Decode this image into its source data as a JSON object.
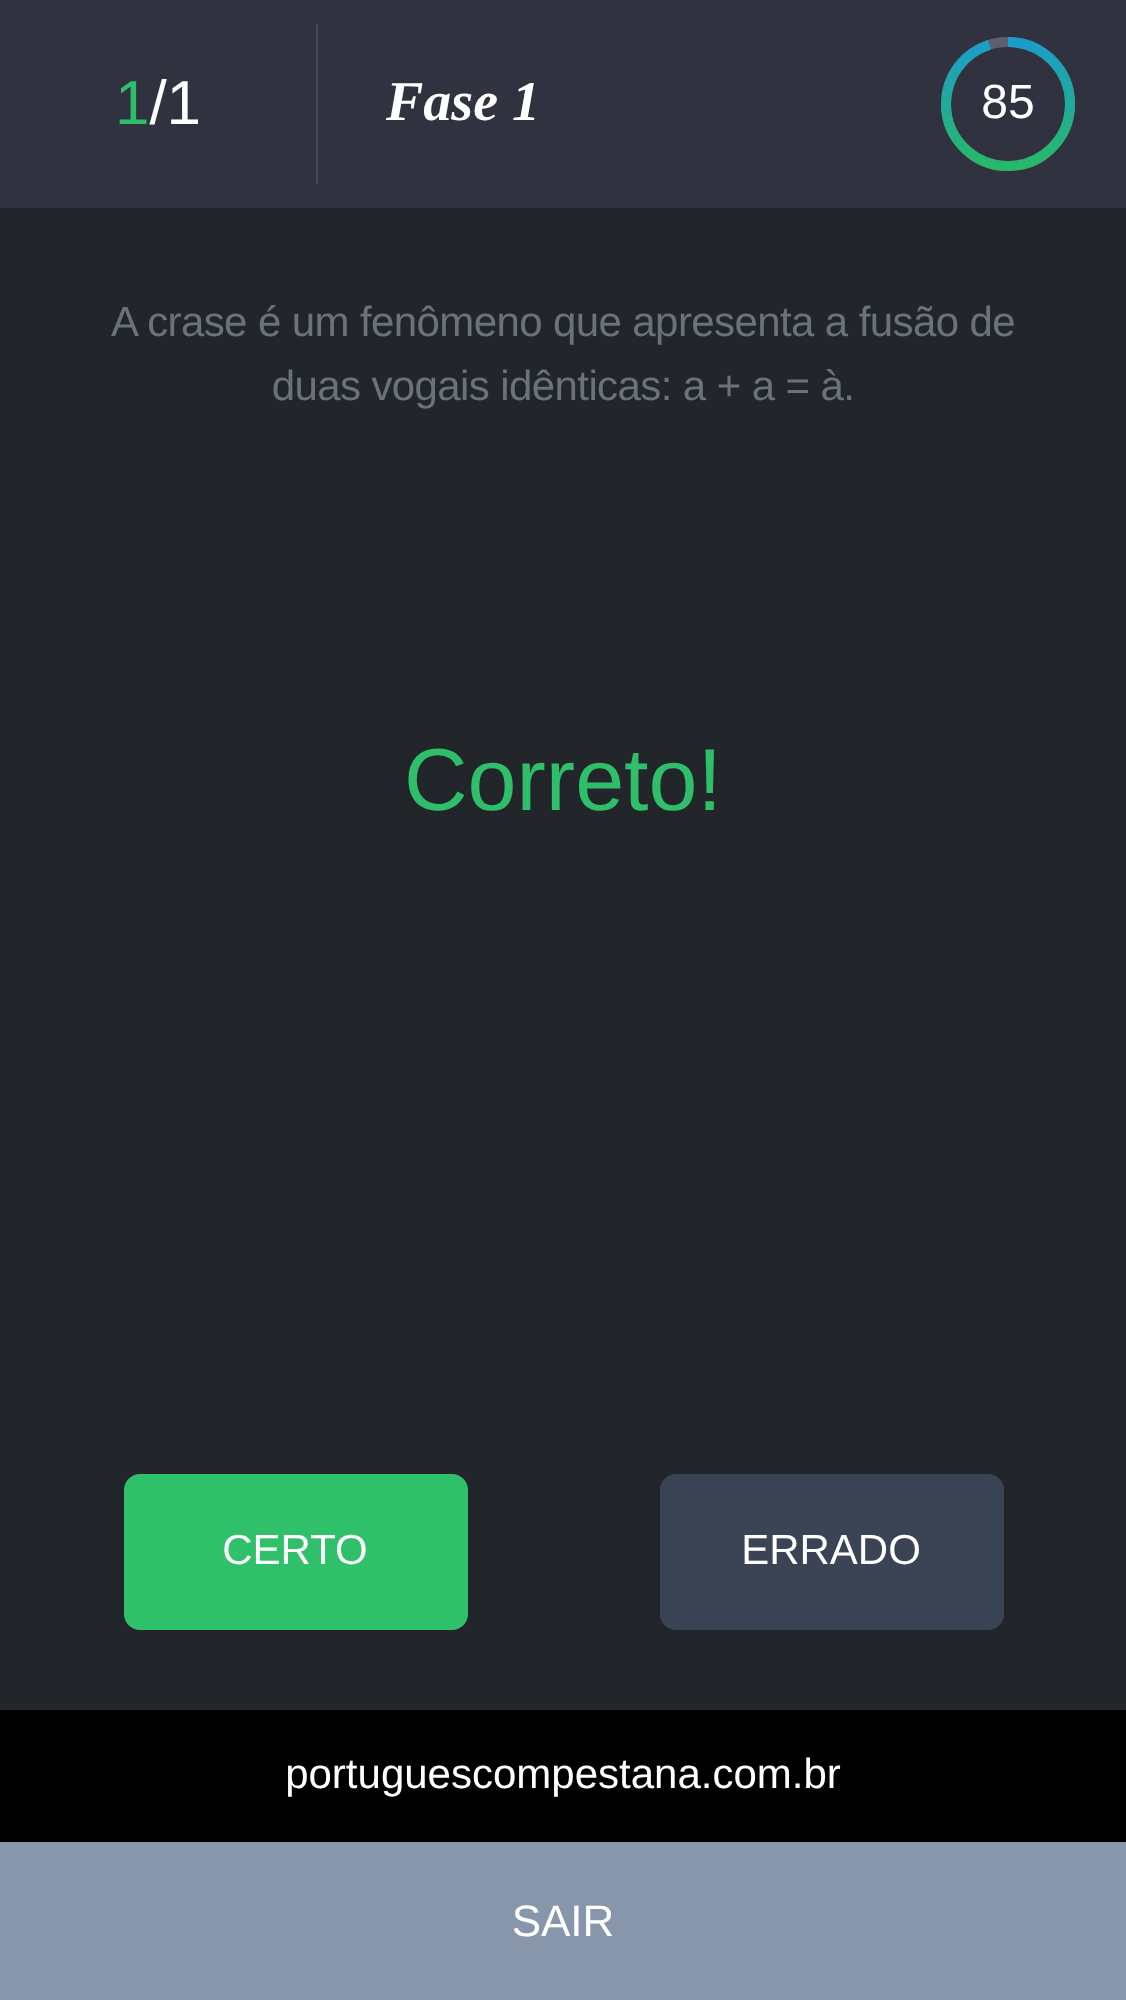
{
  "header": {
    "counter": {
      "current": "1",
      "total": "/1"
    },
    "title": "Fase 1",
    "timer": {
      "value": "85",
      "level": 0.95
    }
  },
  "statement": "A crase é um fenômeno que apresenta a fusão de duas vogais idênticas: a + a = à.",
  "feedback": "Correto!",
  "answers": [
    {
      "label": "CERTO",
      "selected": true
    },
    {
      "label": "ERRADO",
      "selected": false
    }
  ],
  "footer": {
    "website": "portuguescompestana.com.br",
    "exit_button": "SAIR"
  }
}
